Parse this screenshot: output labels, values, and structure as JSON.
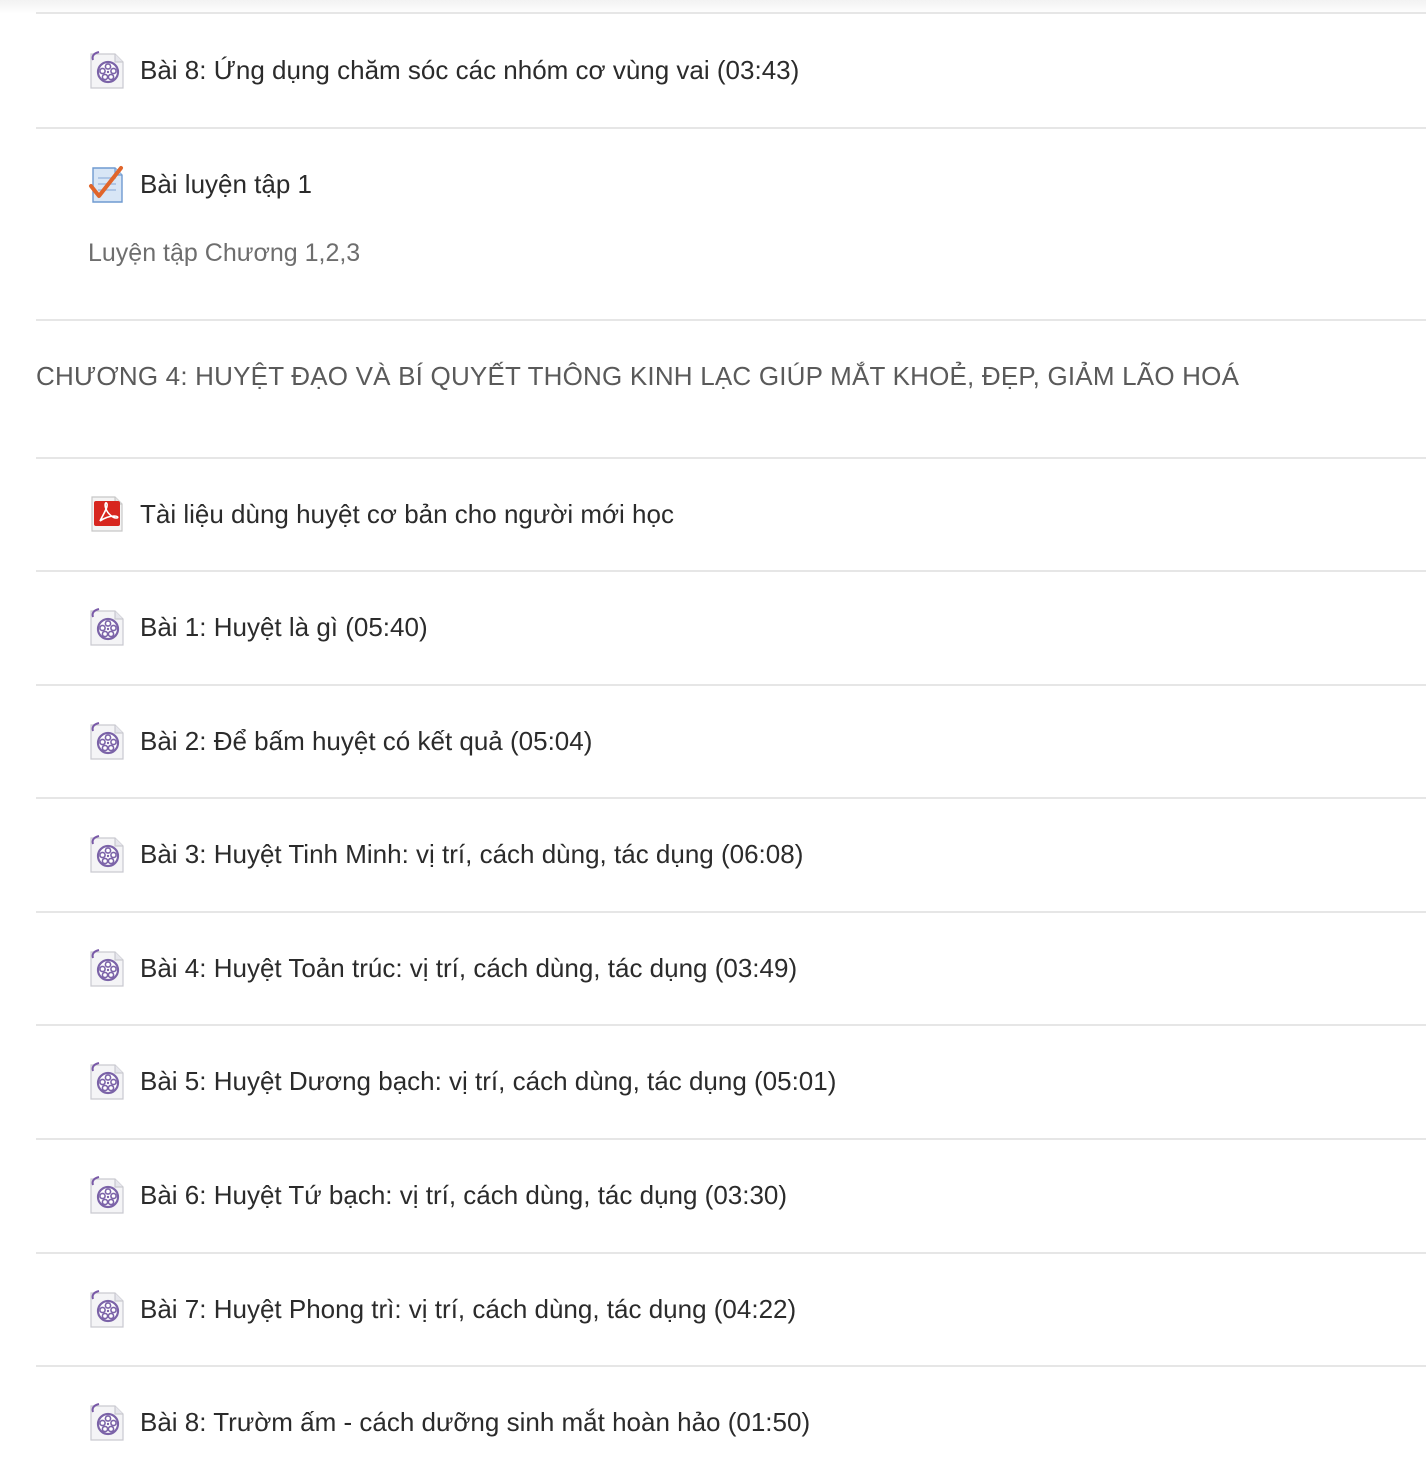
{
  "rows_before": [
    {
      "label": "Bài 8: Ứng dụng chăm sóc các nhóm cơ vùng vai (03:43)",
      "icon": "video-icon"
    },
    {
      "label": "Bài luyện tập 1",
      "icon": "quiz-icon",
      "description": "Luyện tập Chương 1,2,3"
    }
  ],
  "section": {
    "title": "CHƯƠNG 4: HUYỆT ĐẠO VÀ BÍ QUYẾT THÔNG KINH LẠC GIÚP MẮT KHOẺ, ĐẸP, GIẢM LÃO HOÁ"
  },
  "rows_after": [
    {
      "label": "Tài liệu dùng huyệt cơ bản cho người mới học",
      "icon": "pdf-icon"
    },
    {
      "label": "Bài 1: Huyệt là gì (05:40)",
      "icon": "video-icon"
    },
    {
      "label": "Bài 2: Để bấm huyệt có kết quả (05:04)",
      "icon": "video-icon"
    },
    {
      "label": "Bài 3: Huyệt Tinh Minh: vị trí, cách dùng, tác dụng (06:08)",
      "icon": "video-icon"
    },
    {
      "label": "Bài 4: Huyệt Toản trúc: vị trí, cách dùng, tác dụng (03:49)",
      "icon": "video-icon"
    },
    {
      "label": "Bài 5: Huyệt Dương bạch: vị trí, cách dùng, tác dụng (05:01)",
      "icon": "video-icon"
    },
    {
      "label": "Bài 6: Huyệt Tứ bạch: vị trí, cách dùng, tác dụng (03:30)",
      "icon": "video-icon"
    },
    {
      "label": "Bài 7: Huyệt Phong trì: vị trí, cách dùng, tác dụng (04:22)",
      "icon": "video-icon"
    },
    {
      "label": "Bài 8: Trườm ấm - cách dưỡng sinh mắt hoàn hảo (01:50)",
      "icon": "video-icon"
    }
  ]
}
